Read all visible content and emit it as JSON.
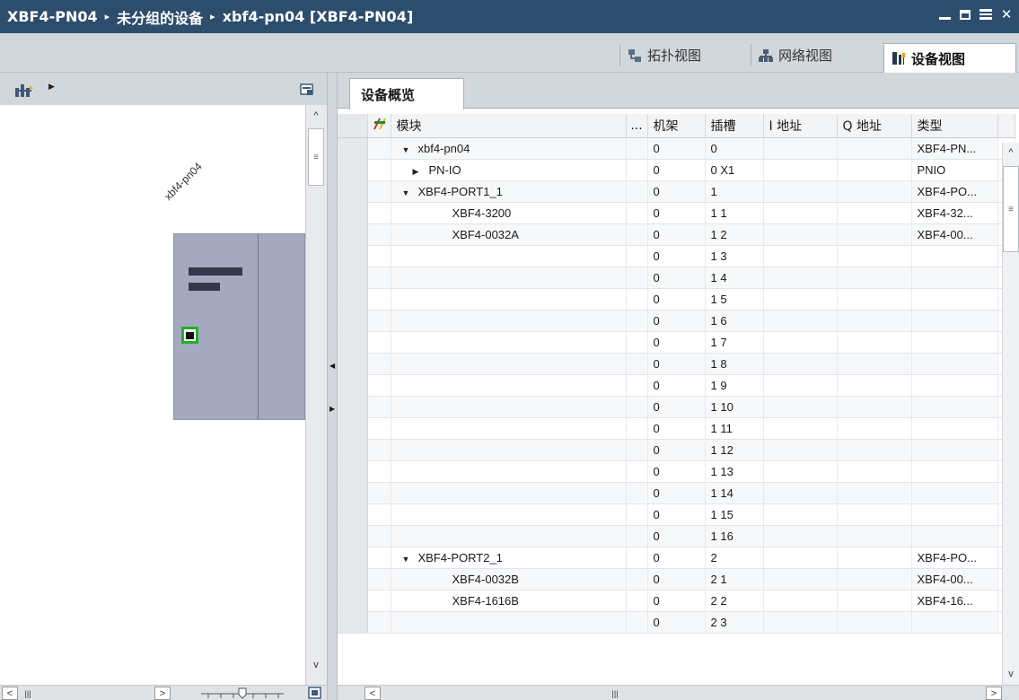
{
  "titlebar": {
    "crumbs": [
      "XBF4-PN04",
      "未分组的设备",
      "xbf4-pn04 [XBF4-PN04]"
    ],
    "separator": "▸",
    "close": "✕"
  },
  "viewtabs": [
    {
      "label": "拓扑视图",
      "icon": "topology-icon"
    },
    {
      "label": "网络视图",
      "icon": "network-icon"
    },
    {
      "label": "设备视图",
      "icon": "device-icon",
      "active": true
    }
  ],
  "left": {
    "device_name": "xbf4-pn04",
    "h_scroll_left": "<",
    "h_scroll_right": ">",
    "h_scroll_grip": "|||",
    "scroll_up": "^",
    "scroll_down": "v",
    "scroll_grip": "≡"
  },
  "overview": {
    "tab_label": "设备概览",
    "columns": [
      "模块",
      "...",
      "机架",
      "插槽",
      "I 地址",
      "Q 地址",
      "类型"
    ],
    "rows": [
      {
        "name": "xbf4-pn04",
        "indent": 1,
        "toggle": "▼",
        "rack": "0",
        "slot": "0",
        "i_addr": "",
        "q_addr": "",
        "type": "XBF4-PN..."
      },
      {
        "name": "PN-IO",
        "indent": 2,
        "toggle": "▶",
        "rack": "0",
        "slot": "0 X1",
        "i_addr": "",
        "q_addr": "",
        "type": "PNIO"
      },
      {
        "name": "XBF4-PORT1_1",
        "indent": 1,
        "toggle": "▼",
        "rack": "0",
        "slot": "1",
        "i_addr": "",
        "q_addr": "",
        "type": "XBF4-PO..."
      },
      {
        "name": "XBF4-3200",
        "indent": 3,
        "toggle": "",
        "rack": "0",
        "slot": "1 1",
        "i_addr": "",
        "q_addr": "",
        "type": "XBF4-32..."
      },
      {
        "name": "XBF4-0032A",
        "indent": 3,
        "toggle": "",
        "rack": "0",
        "slot": "1 2",
        "i_addr": "",
        "q_addr": "",
        "type": "XBF4-00..."
      },
      {
        "name": "",
        "indent": 0,
        "toggle": "",
        "rack": "0",
        "slot": "1 3",
        "i_addr": "",
        "q_addr": "",
        "type": ""
      },
      {
        "name": "",
        "indent": 0,
        "toggle": "",
        "rack": "0",
        "slot": "1 4",
        "i_addr": "",
        "q_addr": "",
        "type": ""
      },
      {
        "name": "",
        "indent": 0,
        "toggle": "",
        "rack": "0",
        "slot": "1 5",
        "i_addr": "",
        "q_addr": "",
        "type": ""
      },
      {
        "name": "",
        "indent": 0,
        "toggle": "",
        "rack": "0",
        "slot": "1 6",
        "i_addr": "",
        "q_addr": "",
        "type": ""
      },
      {
        "name": "",
        "indent": 0,
        "toggle": "",
        "rack": "0",
        "slot": "1 7",
        "i_addr": "",
        "q_addr": "",
        "type": ""
      },
      {
        "name": "",
        "indent": 0,
        "toggle": "",
        "rack": "0",
        "slot": "1 8",
        "i_addr": "",
        "q_addr": "",
        "type": ""
      },
      {
        "name": "",
        "indent": 0,
        "toggle": "",
        "rack": "0",
        "slot": "1 9",
        "i_addr": "",
        "q_addr": "",
        "type": ""
      },
      {
        "name": "",
        "indent": 0,
        "toggle": "",
        "rack": "0",
        "slot": "1 10",
        "i_addr": "",
        "q_addr": "",
        "type": ""
      },
      {
        "name": "",
        "indent": 0,
        "toggle": "",
        "rack": "0",
        "slot": "1 11",
        "i_addr": "",
        "q_addr": "",
        "type": ""
      },
      {
        "name": "",
        "indent": 0,
        "toggle": "",
        "rack": "0",
        "slot": "1 12",
        "i_addr": "",
        "q_addr": "",
        "type": ""
      },
      {
        "name": "",
        "indent": 0,
        "toggle": "",
        "rack": "0",
        "slot": "1 13",
        "i_addr": "",
        "q_addr": "",
        "type": ""
      },
      {
        "name": "",
        "indent": 0,
        "toggle": "",
        "rack": "0",
        "slot": "1 14",
        "i_addr": "",
        "q_addr": "",
        "type": ""
      },
      {
        "name": "",
        "indent": 0,
        "toggle": "",
        "rack": "0",
        "slot": "1 15",
        "i_addr": "",
        "q_addr": "",
        "type": ""
      },
      {
        "name": "",
        "indent": 0,
        "toggle": "",
        "rack": "0",
        "slot": "1 16",
        "i_addr": "",
        "q_addr": "",
        "type": ""
      },
      {
        "name": "XBF4-PORT2_1",
        "indent": 1,
        "toggle": "▼",
        "rack": "0",
        "slot": "2",
        "i_addr": "",
        "q_addr": "",
        "type": "XBF4-PO..."
      },
      {
        "name": "XBF4-0032B",
        "indent": 3,
        "toggle": "",
        "rack": "0",
        "slot": "2 1",
        "i_addr": "",
        "q_addr": "",
        "type": "XBF4-00..."
      },
      {
        "name": "XBF4-1616B",
        "indent": 3,
        "toggle": "",
        "rack": "0",
        "slot": "2 2",
        "i_addr": "",
        "q_addr": "",
        "type": "XBF4-16..."
      },
      {
        "name": "",
        "indent": 0,
        "toggle": "",
        "rack": "0",
        "slot": "2 3",
        "i_addr": "",
        "q_addr": "",
        "type": ""
      }
    ],
    "h_scroll_left": "<",
    "h_scroll_right": ">",
    "h_scroll_grip": "|||",
    "scroll_up": "^",
    "scroll_down": "v",
    "scroll_grip": "≡"
  },
  "colors": {
    "titlebar": "#2d4d6d",
    "toolbar": "#d2d7dc",
    "module_body": "#a4a9bf",
    "port_green": "#22b02a"
  }
}
